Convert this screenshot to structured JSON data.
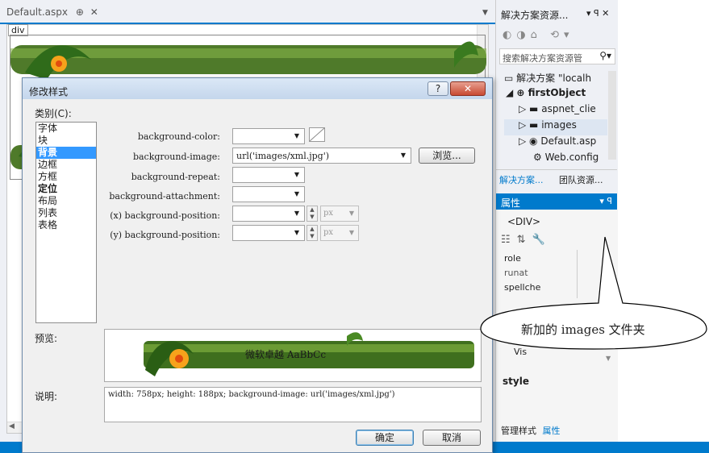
{
  "editor": {
    "tab_title": "Default.aspx",
    "tab_pin": "⊕",
    "tab_close": "✕",
    "tag_label": "div"
  },
  "solution_explorer": {
    "title": "解决方案资源...",
    "title_controls": "▾ ꟼ ✕",
    "search_placeholder": "搜索解决方案资源管",
    "items": [
      {
        "label": "解决方案 \"localh",
        "level": 0
      },
      {
        "label": "firstObject",
        "level": 1
      },
      {
        "label": "aspnet_clie",
        "level": 2
      },
      {
        "label": "images",
        "level": 2
      },
      {
        "label": "Default.asp",
        "level": 2
      },
      {
        "label": "Web.config",
        "level": 3
      }
    ],
    "tabs": [
      "解决方案...",
      "团队资源..."
    ]
  },
  "properties": {
    "title": "属性",
    "selected_object": "<DIV>",
    "rows": [
      "role",
      "runat",
      "spellche"
    ],
    "vis_label": "Vis",
    "section": "style",
    "bottom_tabs": [
      "管理样式",
      "属性"
    ]
  },
  "dialog": {
    "title": "修改样式",
    "help_btn": "?",
    "close_btn": "✕",
    "category_label": "类别(C):",
    "categories": [
      "字体",
      "块",
      "背景",
      "边框",
      "方框",
      "定位",
      "布局",
      "列表",
      "表格"
    ],
    "selected_category": "背景",
    "fields": {
      "bg_color": "background-color:",
      "bg_image": "background-image:",
      "bg_image_value": "url('images/xml.jpg')",
      "browse": "浏览...",
      "bg_repeat": "background-repeat:",
      "bg_attachment": "background-attachment:",
      "bg_pos_x": "(x) background-position:",
      "bg_pos_y": "(y) background-position:",
      "unit": "px"
    },
    "preview_label": "预览:",
    "preview_text": "微软卓越 AaBbCc",
    "desc_label": "说明:",
    "desc_text": "width: 758px; height: 188px; background-image: url('images/xml.jpg')",
    "ok": "确定",
    "cancel": "取消"
  },
  "callout": {
    "text": "新加的 images 文件夹"
  }
}
